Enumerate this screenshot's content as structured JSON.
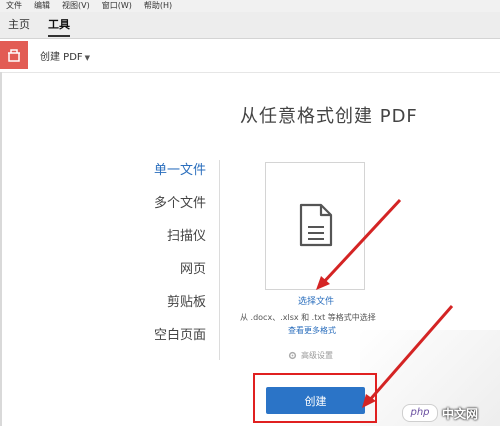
{
  "menubar": {
    "items": [
      "文件",
      "编辑",
      "视图(V)",
      "窗口(W)",
      "帮助(H)"
    ]
  },
  "tabs": {
    "home": "主页",
    "tools": "工具"
  },
  "toolbar": {
    "create_pdf_label": "创建 PDF",
    "icon": "create-pdf-icon"
  },
  "main": {
    "heading": "从任意格式创建 PDF",
    "options": [
      "单一文件",
      "多个文件",
      "扫描仪",
      "网页",
      "剪贴板",
      "空白页面"
    ],
    "active_option": "单一文件",
    "file_card": {
      "icon": "document-icon",
      "select_file_link": "选择文件",
      "formats_text": "从 .docx、.xlsx 和 .txt 等格式中选择",
      "more_formats_link": "查看更多格式"
    },
    "advanced_settings": "高级设置",
    "create_button": "创建"
  },
  "watermark": {
    "logo": "php",
    "text": "中文网"
  },
  "colors": {
    "accent_blue": "#2b74c7",
    "link_blue": "#2a6ebd",
    "tool_red": "#e25c54",
    "annotation_red": "#e02020"
  }
}
